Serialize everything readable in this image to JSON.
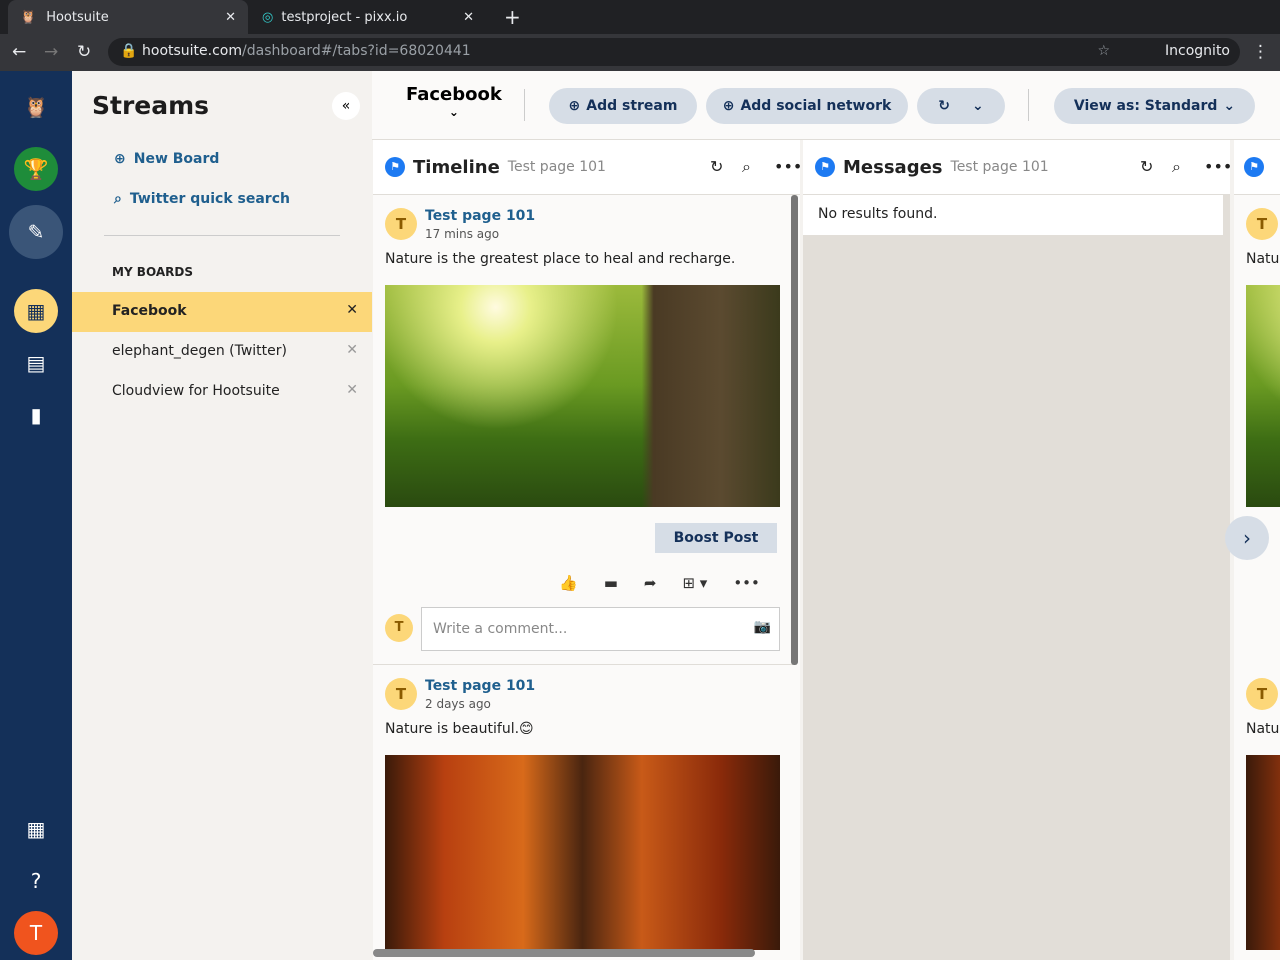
{
  "browser": {
    "tabs": [
      {
        "title": "Hootsuite"
      },
      {
        "title": "testproject - pixx.io"
      }
    ],
    "url_domain": "hootsuite.com",
    "url_path": "/dashboard#/tabs?id=68020441",
    "profile": "Incognito"
  },
  "sidebar": {
    "title": "Streams",
    "new_board": "New Board",
    "quick_search": "Twitter quick search",
    "boards_heading": "MY BOARDS",
    "boards": [
      {
        "label": "Facebook"
      },
      {
        "label": "elephant_degen (Twitter)"
      },
      {
        "label": "Cloudview for Hootsuite"
      }
    ]
  },
  "rail": {
    "avatar_letter": "T"
  },
  "toolbar": {
    "board": "Facebook",
    "add_stream": "Add stream",
    "add_network": "Add social network",
    "view_as": "View as: Standard"
  },
  "streams": [
    {
      "title": "Timeline",
      "subtitle": "Test page 101",
      "posts": [
        {
          "author": "Test page 101",
          "time": "17 mins ago",
          "text": "Nature is the greatest place to heal and recharge."
        },
        {
          "author": "Test page 101",
          "time": "2 days ago",
          "text": "Nature is beautiful.😊"
        }
      ],
      "boost": "Boost Post",
      "comment_placeholder": "Write a comment..."
    },
    {
      "title": "Messages",
      "subtitle": "Test page 101",
      "empty": "No results found."
    },
    {
      "partial_text": "Natu"
    }
  ],
  "colors": {
    "rail": "#143059",
    "accent": "#fcd779",
    "link": "#1f5f8e"
  }
}
